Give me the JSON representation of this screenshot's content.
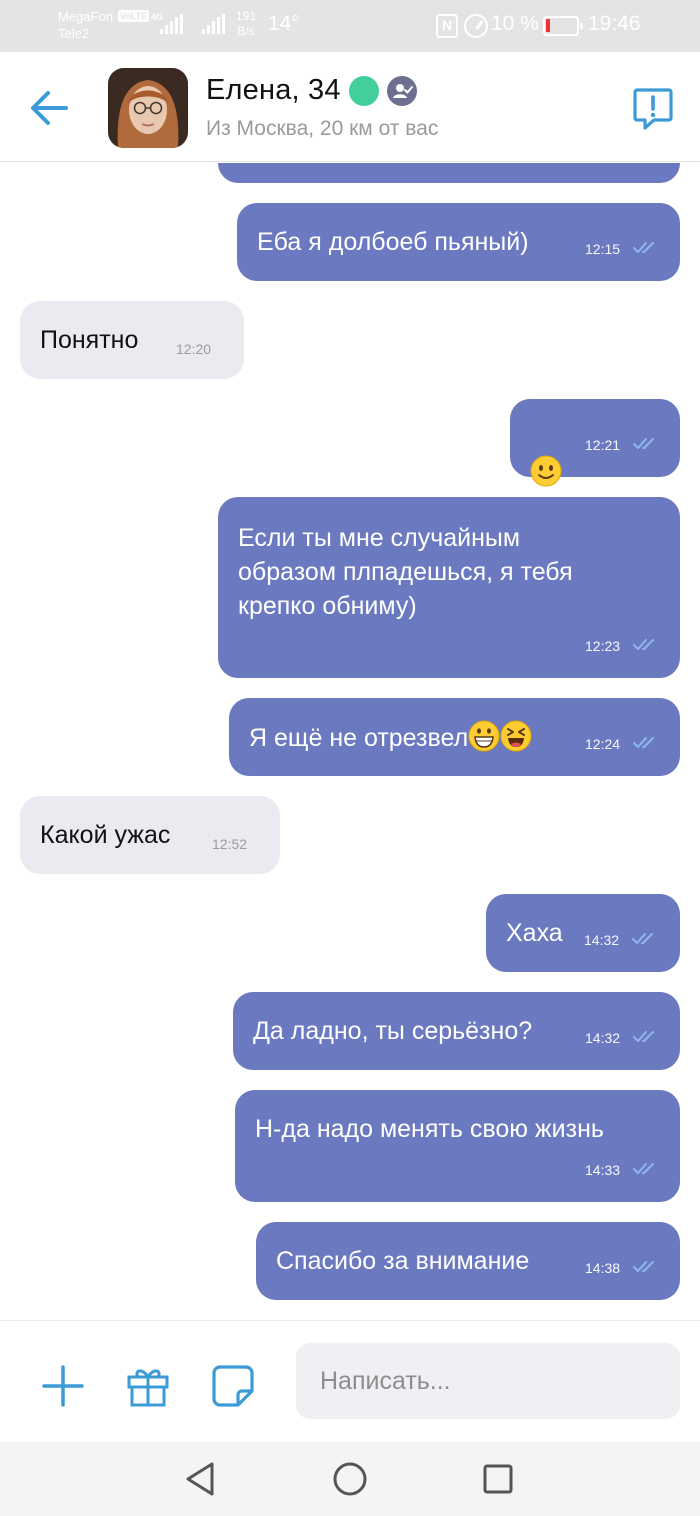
{
  "status_bar": {
    "carrier1": "MegaFon",
    "carrier2": "Tele2",
    "volte": "VoLTE",
    "network": "4G",
    "speed_value": "191",
    "speed_unit": "B/s",
    "temperature": "14°",
    "battery": "10 %",
    "time": "19:46"
  },
  "header": {
    "name": "Елена, 34",
    "location": "Из Москва, 20 км от вас",
    "online_color": "#43cf9c",
    "accent_color": "#3c9bd6"
  },
  "messages": [
    {
      "direction": "out",
      "text": "Еба я долбоеб пьяный)",
      "time": "12:15"
    },
    {
      "direction": "in",
      "text": "Понятно",
      "time": "12:20"
    },
    {
      "direction": "out",
      "text": "",
      "emoji": "slightly-smiling-face",
      "time": "12:21"
    },
    {
      "direction": "out",
      "text": "Если ты мне случайным\nобразом плпадешься, я тебя\nкрепко обниму)",
      "time": "12:23"
    },
    {
      "direction": "out",
      "text": "Я ещё не отрезвел",
      "emoji": "grinning-face, laughing-face",
      "time": "12:24"
    },
    {
      "direction": "in",
      "text": "Какой ужас",
      "time": "12:52"
    },
    {
      "direction": "out",
      "text": "Хаха",
      "time": "14:32"
    },
    {
      "direction": "out",
      "text": "Да ладно, ты серьёзно?",
      "time": "14:32"
    },
    {
      "direction": "out",
      "text": "Н-да надо менять свою жизнь",
      "time": "14:33"
    },
    {
      "direction": "out",
      "text": "Спасибо за внимание",
      "time": "14:38"
    }
  ],
  "composer": {
    "placeholder": "Написать..."
  },
  "colors": {
    "outgoing_bubble": "#6b7ac0",
    "incoming_bubble": "#e9ebf1"
  }
}
